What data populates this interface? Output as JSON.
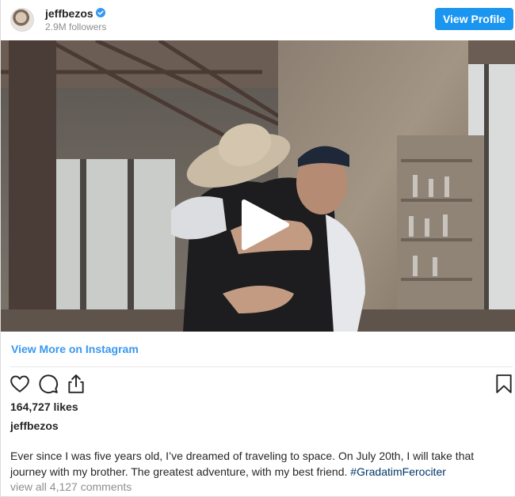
{
  "header": {
    "username": "jeffbezos",
    "followers": "2.9M followers",
    "view_profile_label": "View Profile"
  },
  "media": {
    "type": "video",
    "play_icon": "play-icon"
  },
  "view_more_label": "View More on Instagram",
  "actions": {
    "like_icon": "heart-icon",
    "comment_icon": "comment-icon",
    "share_icon": "share-icon",
    "save_icon": "bookmark-icon"
  },
  "likes": "164,727 likes",
  "caption": {
    "username": "jeffbezos",
    "text": "Ever since I was five years old, I’ve dreamed of traveling to space. On July 20th, I will take that journey with my brother. The greatest adventure, with my best friend. ",
    "hashtag": "#GradatimFerociter"
  },
  "comments_link": "view all 4,127 comments",
  "colors": {
    "accent": "#1a95f0",
    "link": "#3897f0",
    "hashtag": "#003569",
    "muted": "#8e8e8e"
  }
}
